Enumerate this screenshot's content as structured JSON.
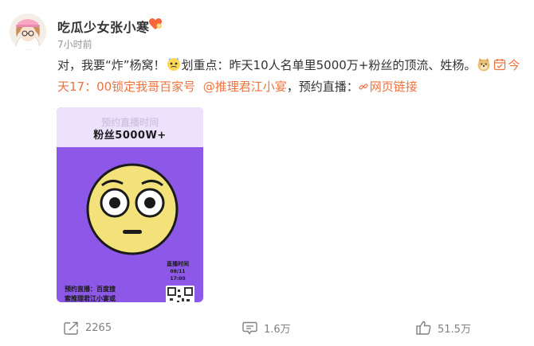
{
  "post": {
    "author": "吃瓜少女张小寒",
    "time": "7小时前",
    "text_lines": [
      "对，我要“炸”杨窝！",
      "划重点：昨天10人名单里5000万+粉丝的顶流、姓杨。",
      "今",
      "天17：00锁定我哥百家号",
      "@推理君江小宴",
      "，预约直播：",
      "网页链接"
    ]
  },
  "poster": {
    "top_text": "预约直播时间",
    "banner": "粉丝5000W+",
    "live_label": "直播时间",
    "live_date": "08/11",
    "live_time": "17:00",
    "note_line1": "预约直播：百度搜",
    "note_line2": "索推理君江小宴或"
  },
  "actions": {
    "repost_count": "2265",
    "comment_count": "1.6万",
    "like_count": "51.5万"
  },
  "colors": {
    "link": "#eb7340",
    "poster_purple": "#8d58e8",
    "face_yellow": "#f3e27a"
  },
  "icons": [
    "avatar-illustration",
    "vip-heart-icon",
    "nervous-emoji-icon",
    "doge-emoji-icon",
    "calendar-icon",
    "link-icon",
    "repost-icon",
    "comment-icon",
    "like-icon"
  ]
}
